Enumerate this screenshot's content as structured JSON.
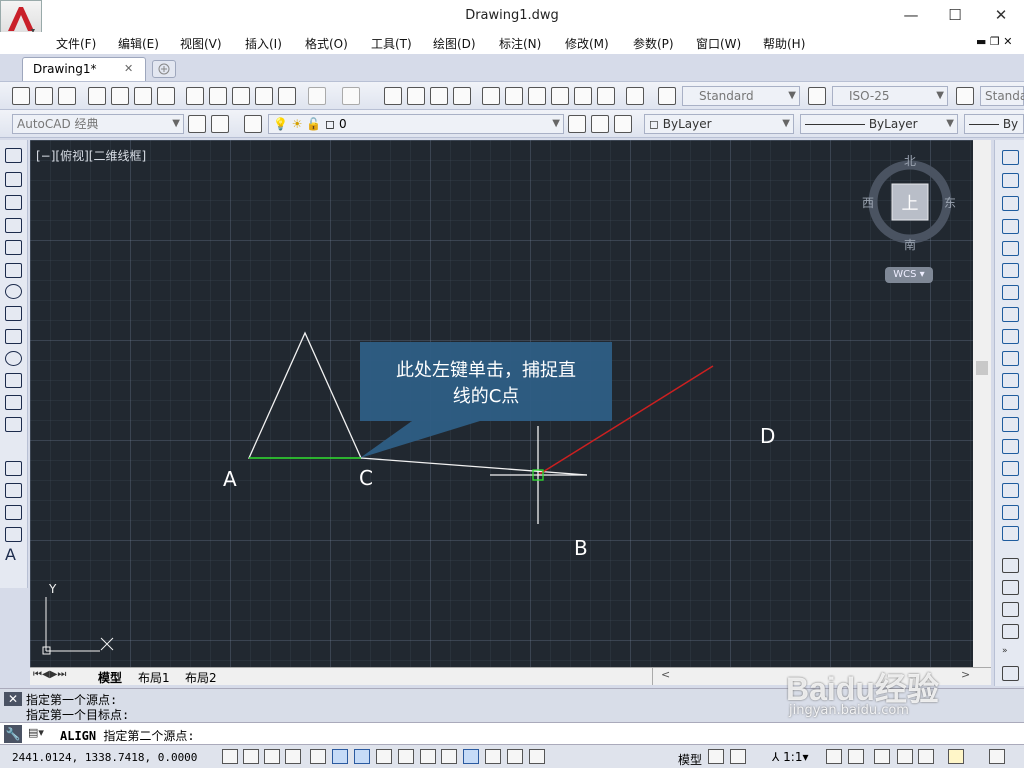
{
  "window": {
    "title": "Drawing1.dwg",
    "minimize": "—",
    "maximize": "☐",
    "close": "✕"
  },
  "menu": [
    "文件(F)",
    "编辑(E)",
    "视图(V)",
    "插入(I)",
    "格式(O)",
    "工具(T)",
    "绘图(D)",
    "标注(N)",
    "修改(M)",
    "参数(P)",
    "窗口(W)",
    "帮助(H)"
  ],
  "tabs": {
    "doc_tab": "Drawing1*",
    "close_glyph": "✕"
  },
  "toolbar": {
    "text_style": "Standard",
    "dim_style": "ISO-25",
    "table_style": "Standa",
    "workspace": "AutoCAD 经典",
    "layer": "0",
    "color": "ByLayer",
    "linetype": "ByLayer",
    "lineweight": "By"
  },
  "viewport": {
    "label": "[−][俯视][二维线框]"
  },
  "viewcube": {
    "north": "北",
    "south": "南",
    "east": "东",
    "west": "西",
    "top": "上",
    "wcs": "WCS"
  },
  "callout": {
    "line1": "此处左键单击，捕捉直",
    "line2": "线的C点"
  },
  "points": {
    "a": "A",
    "b": "B",
    "c": "C",
    "d": "D"
  },
  "ucs": {
    "y": "Y"
  },
  "layout_tabs": [
    "模型",
    "布局1",
    "布局2"
  ],
  "command_history": [
    "指定第一个源点:",
    "指定第一个目标点:"
  ],
  "command_line": {
    "command": "ALIGN",
    "prompt": "指定第二个源点:"
  },
  "status": {
    "coords": "2441.0124, 1338.7418, 0.0000",
    "model": "模型",
    "scale": "1:1"
  },
  "watermark": {
    "brand": "Baidu经验",
    "url": "jingyan.baidu.com"
  },
  "colors": {
    "canvas": "#212830",
    "callout": "#2e5e85",
    "red_line": "#cc2020",
    "green_segment": "#1fd01f"
  }
}
